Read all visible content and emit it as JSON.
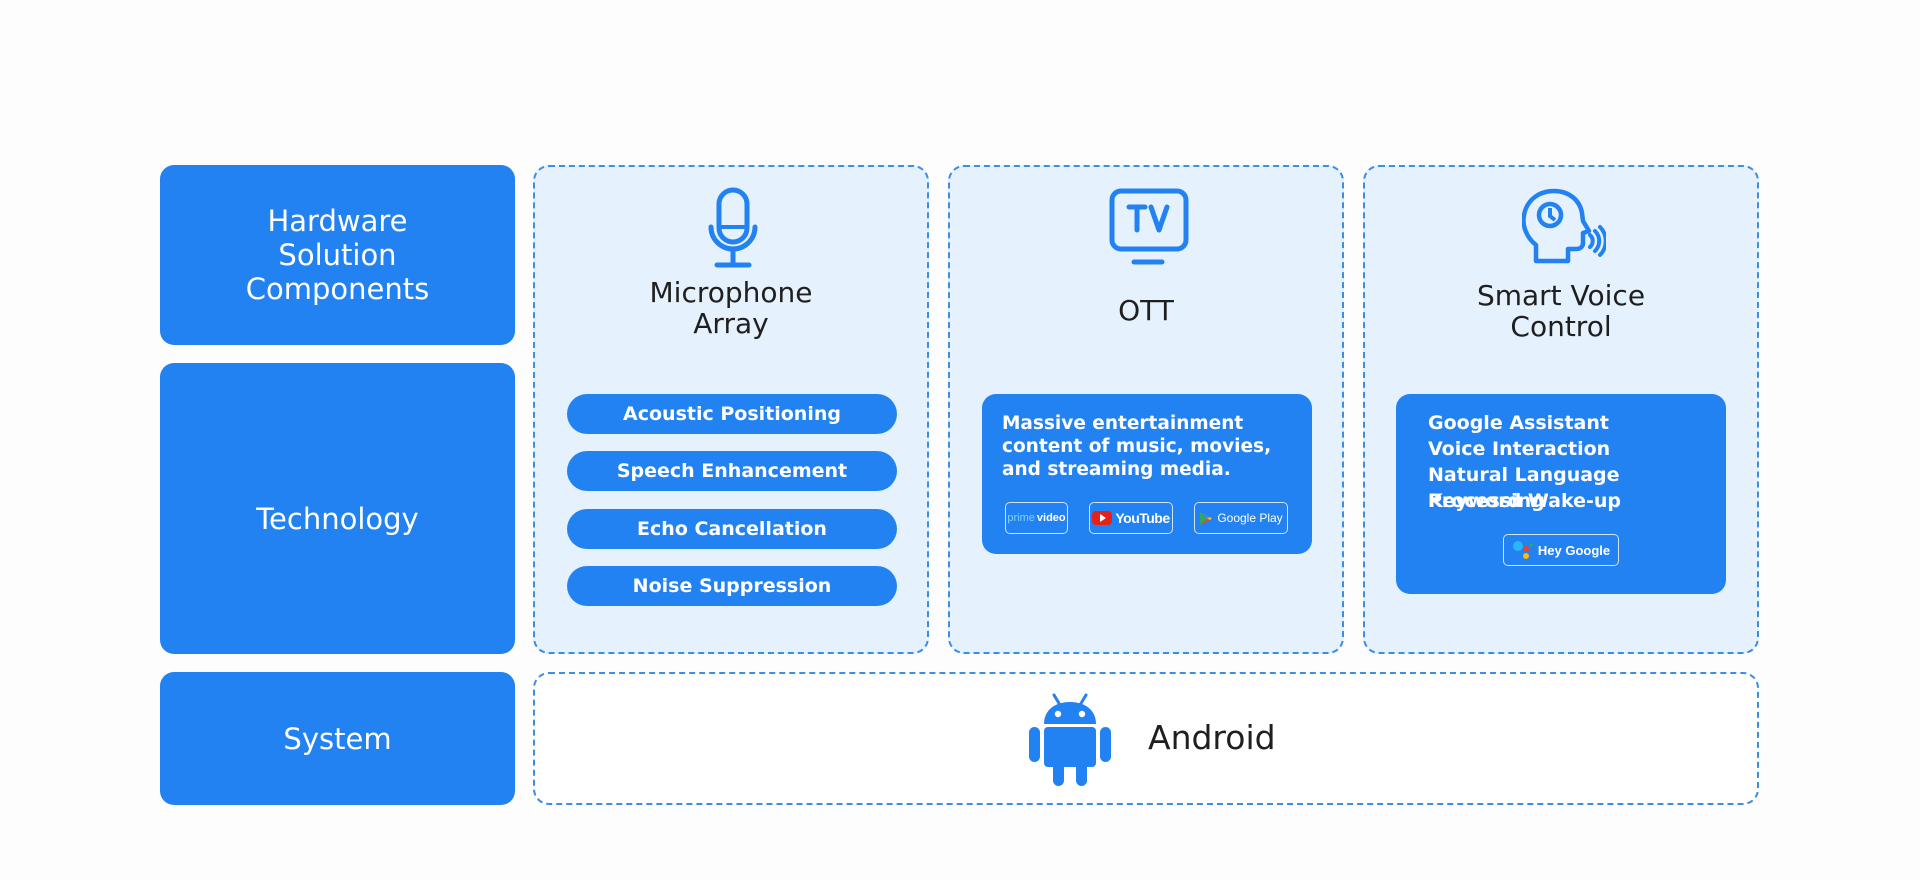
{
  "rows": {
    "hardware": "Hardware\nSolution\nComponents",
    "hardware_lines": [
      "Hardware",
      "Solution",
      "Components"
    ],
    "technology": "Technology",
    "system": "System"
  },
  "microphone": {
    "title_lines": [
      "Microphone",
      "Array"
    ],
    "icon": "microphone-icon",
    "features": [
      "Acoustic Positioning",
      "Speech Enhancement",
      "Echo Cancellation",
      "Noise Suppression"
    ]
  },
  "ott": {
    "title": "OTT",
    "icon": "tv-icon",
    "description": "Massive entertainment content of music, movies, and streaming media.",
    "logos": [
      {
        "name": "prime video",
        "prime": "prime",
        "video": "video"
      },
      {
        "name": "YouTube"
      },
      {
        "name": "Google Play"
      }
    ]
  },
  "smart_voice": {
    "title_lines": [
      "Smart Voice",
      "Control"
    ],
    "icon": "speaking-head-icon",
    "features": [
      "Google Assistant",
      "Voice Interaction",
      "Natural Language Processing",
      "Keyword Wake-up"
    ],
    "badge": "Hey Google"
  },
  "system": {
    "os": "Android",
    "icon": "android-icon"
  },
  "colors": {
    "primary": "#2382f1",
    "card_bg": "#e5f1fd",
    "dashed_border": "#3d8de3",
    "text_dark": "#1f1f1f"
  }
}
